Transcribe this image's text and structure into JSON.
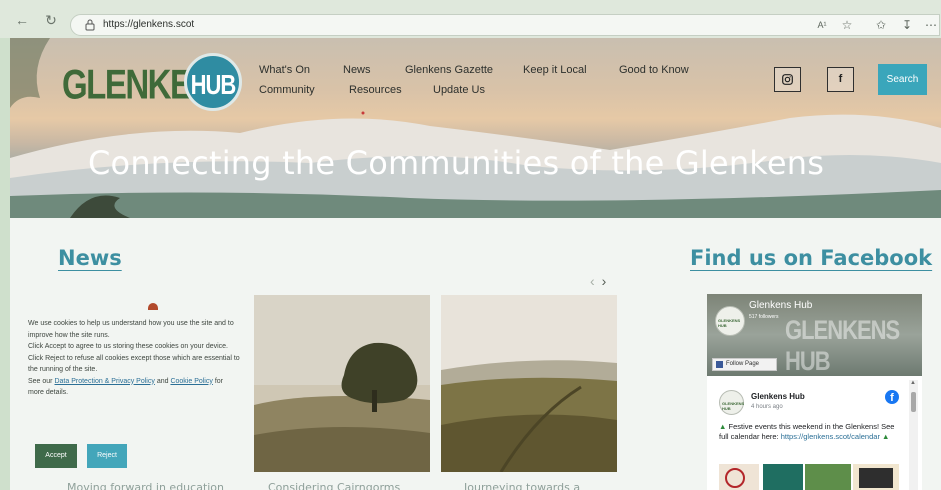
{
  "browser": {
    "url": "https://glenkens.scot",
    "read_aloud_label": "A¹"
  },
  "site": {
    "logo_text": "GLENKENS",
    "logo_badge": "HUB",
    "menu": {
      "row1": [
        "What's On",
        "News",
        "Glenkens Gazette",
        "Keep it Local",
        "Good to Know"
      ],
      "row2": [
        "Community",
        "Resources",
        "Update Us"
      ]
    },
    "social": {
      "facebook_glyph": "f"
    },
    "search_label": "Search",
    "headline": "Connecting the Communities of the Glenkens"
  },
  "news": {
    "title": "News",
    "cards": [
      {
        "title": "Moving forward in education"
      },
      {
        "title": "Considering Cairngorms"
      },
      {
        "title": "Journeying towards a"
      }
    ]
  },
  "cookie": {
    "line1": "We use cookies to help us understand how you use the site and to improve how the site runs.",
    "line2": "Click Accept to agree to us storing these cookies on your device.",
    "line3": "Click Reject to refuse all cookies except those which are essential to the running of the site.",
    "line4_prefix": "See our",
    "privacy_link": "Data Protection & Privacy Policy",
    "and": "and",
    "cookie_link": "Cookie Policy",
    "line4_suffix": "for more details.",
    "accept_label": "Accept",
    "reject_label": "Reject"
  },
  "facebook": {
    "title": "Find us on Facebook",
    "page_name": "Glenkens Hub",
    "followers": "517 followers",
    "cover_text": "GLENKENS HUB",
    "follow_label": "Follow Page",
    "post_author": "Glenkens Hub",
    "post_time": "4 hours ago",
    "post_text": "Festive events this weekend in the Glenkens! See full calendar here:",
    "post_link": "https://glenkens.scot/calendar",
    "logo_mini": "GLENKENS HUB"
  },
  "colors": {
    "accent": "#3d8fa1",
    "search": "#3aa6bb",
    "accept": "#3f6a4a",
    "reject": "#43a6ba",
    "logo_green": "#3f6a39",
    "hub_blue": "#2f8ca2"
  }
}
